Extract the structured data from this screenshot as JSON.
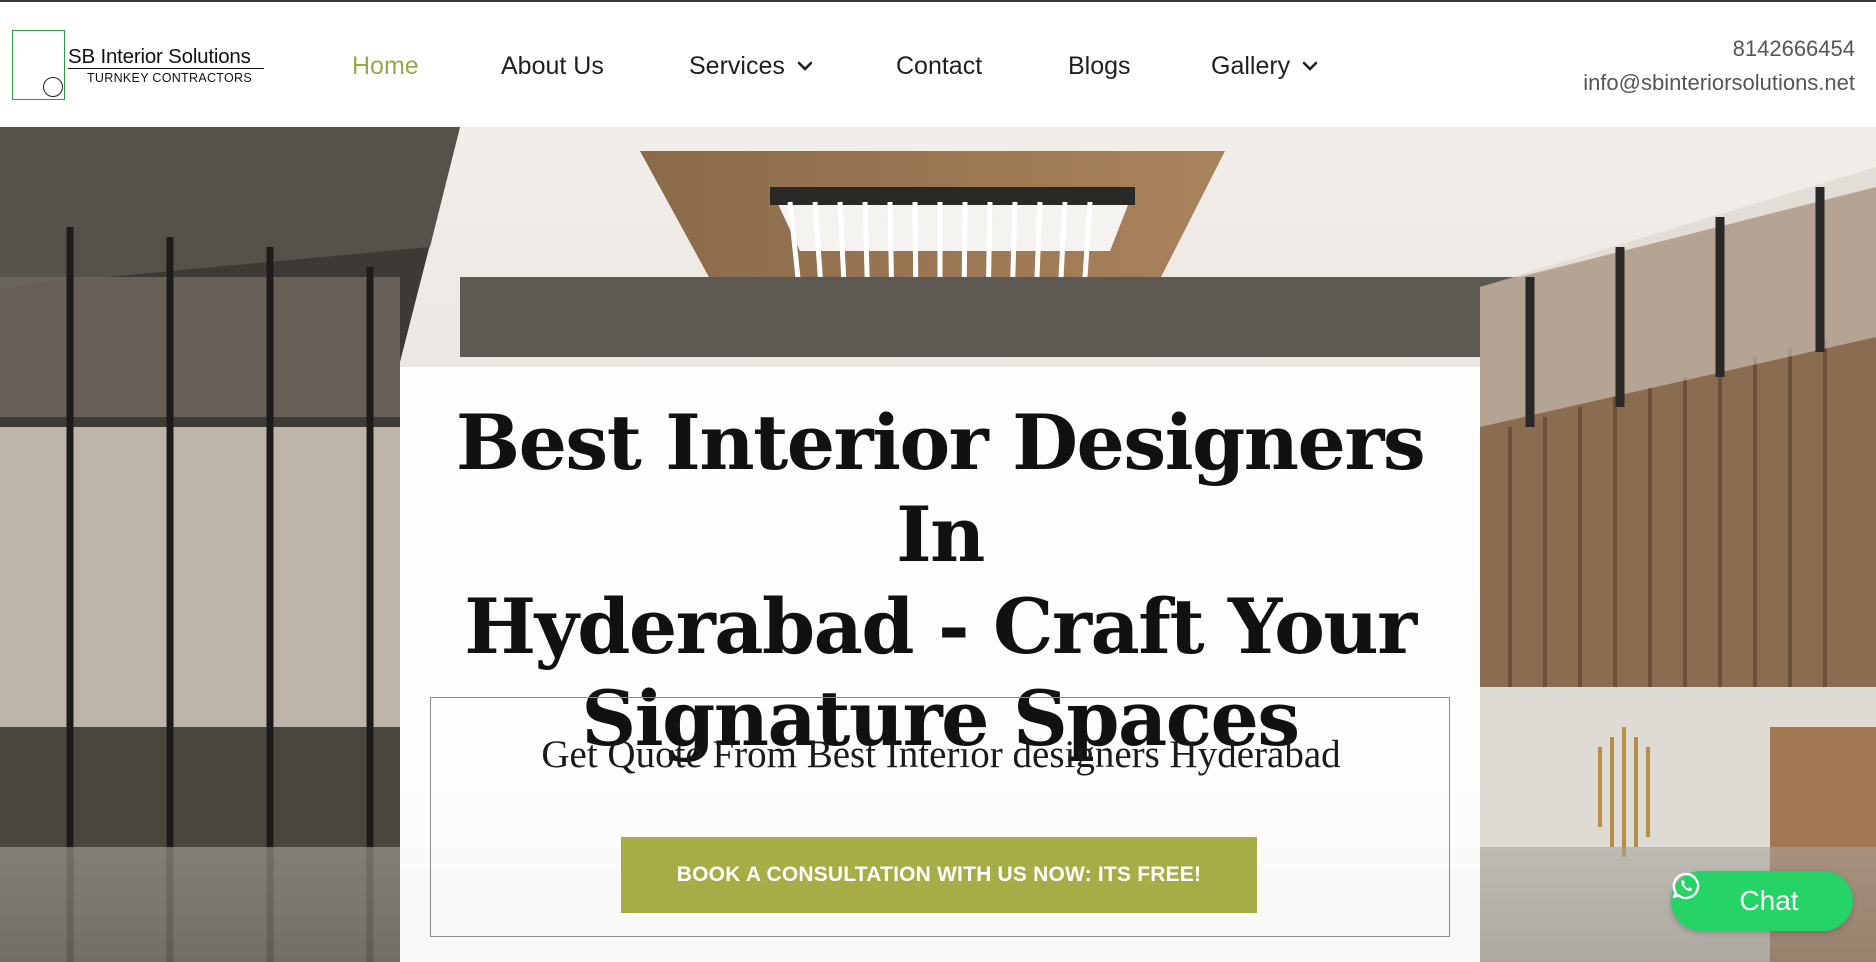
{
  "brand": {
    "title": "SB Interior Solutions",
    "subtitle": "TURNKEY CONTRACTORS"
  },
  "nav": {
    "items": [
      {
        "label": "Home",
        "active": true,
        "dropdown": false
      },
      {
        "label": "About Us",
        "active": false,
        "dropdown": false
      },
      {
        "label": "Services",
        "active": false,
        "dropdown": true
      },
      {
        "label": "Contact",
        "active": false,
        "dropdown": false
      },
      {
        "label": "Blogs",
        "active": false,
        "dropdown": false
      },
      {
        "label": "Gallery",
        "active": false,
        "dropdown": true
      }
    ]
  },
  "contact": {
    "phone": "8142666454",
    "email": "info@sbinteriorsolutions.net"
  },
  "hero": {
    "title_lines": [
      "Best Interior Designers In",
      "Hyderabad - Craft Your",
      "Signature Spaces"
    ],
    "quote_title": "Get Quote From Best Interior designers Hyderabad",
    "cta_label": "BOOK A CONSULTATION WITH US NOW: ITS FREE!"
  },
  "chat": {
    "label": "Chat",
    "icon": "whatsapp-icon"
  },
  "colors": {
    "accent": "#a6ad46",
    "nav_active": "#9aa84a",
    "chat": "#25d366",
    "logo_green": "#2f9a48"
  }
}
